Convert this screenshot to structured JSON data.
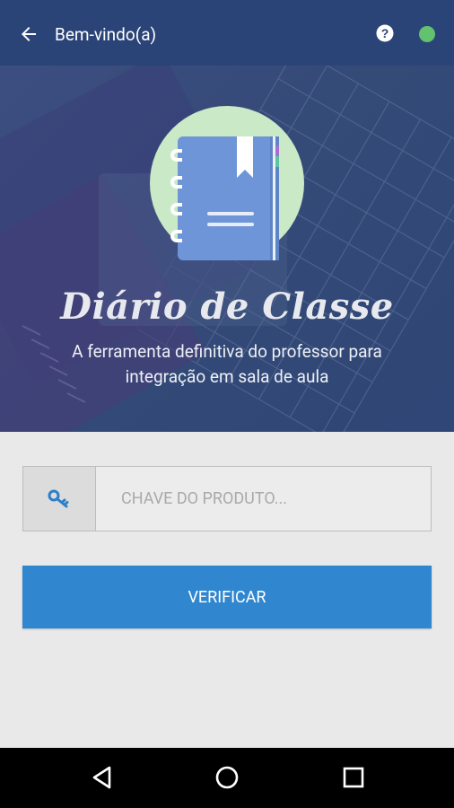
{
  "appbar": {
    "title": "Bem-vindo(a)",
    "back_icon": "arrow-left-icon",
    "help_icon": "help-circle-icon",
    "status_color": "#62c26d",
    "background": "#2b4477"
  },
  "hero": {
    "title": "Diário de Classe",
    "subtitle": "A ferramenta definitiva do professor para integração em sala de aula",
    "logo_icon": "notebook-icon"
  },
  "form": {
    "key_icon": "key-icon",
    "key_placeholder": "CHAVE DO PRODUTO...",
    "key_value": "",
    "verify_label": "VERIFICAR",
    "button_color": "#3087d0"
  },
  "navbar": {
    "back_icon": "nav-back-triangle-icon",
    "home_icon": "nav-home-circle-icon",
    "recents_icon": "nav-recents-square-icon"
  }
}
